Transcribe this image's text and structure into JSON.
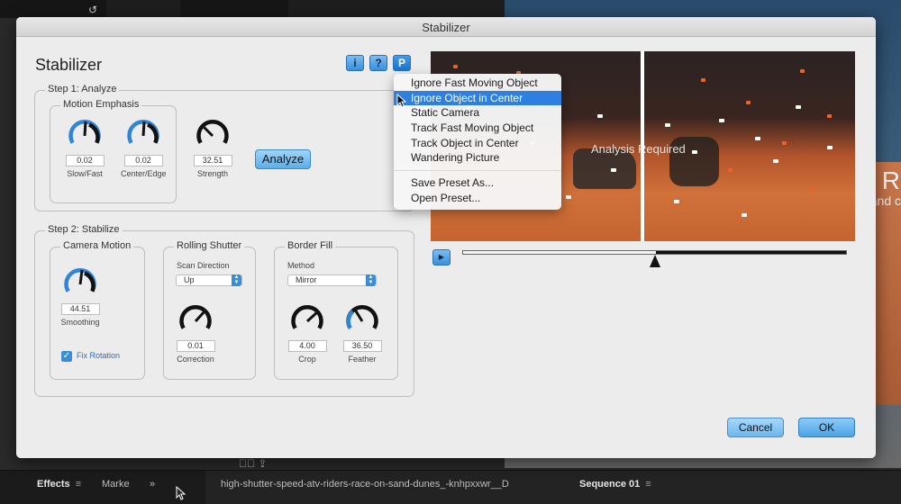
{
  "background": {
    "bottom_tabs": [
      {
        "label": "Effects",
        "active": true
      },
      {
        "label": "Marke",
        "active": false
      }
    ],
    "overflow_glyph": "»",
    "clip_name": "high-shutter-speed-atv-riders-race-on-sand-dunes_-knhpxxwr__D",
    "sequence_tab": "Sequence 01",
    "menu_glyph": "≡",
    "side_text_large": "s R",
    "side_text_small": "and c"
  },
  "dialog": {
    "window_title": "Stabilizer",
    "heading": "Stabilizer",
    "toolbar": {
      "info_label": "i",
      "help_label": "?",
      "preset_label": "P"
    },
    "step1": {
      "label": "Step 1: Analyze",
      "motion_emphasis_label": "Motion Emphasis",
      "knobs": [
        {
          "value": "0.02",
          "label": "Slow/Fast"
        },
        {
          "value": "0.02",
          "label": "Center/Edge"
        },
        {
          "value": "32.51",
          "label": "Strength"
        }
      ],
      "analyze_label": "Analyze"
    },
    "step2": {
      "label": "Step 2: Stabilize",
      "camera_motion": {
        "label": "Camera Motion",
        "knob": {
          "value": "44.51",
          "label": "Smoothing"
        },
        "fix_rotation_label": "Fix Rotation",
        "fix_rotation_checked": true
      },
      "rolling_shutter": {
        "label": "Rolling Shutter",
        "scan_direction_label": "Scan Direction",
        "scan_direction_value": "Up",
        "knob": {
          "value": "0.01",
          "label": "Correction"
        }
      },
      "border_fill": {
        "label": "Border Fill",
        "method_label": "Method",
        "method_value": "Mirror",
        "knobs": [
          {
            "value": "4.00",
            "label": "Crop"
          },
          {
            "value": "36.50",
            "label": "Feather"
          }
        ]
      }
    },
    "preview": {
      "message": "Analysis Required",
      "scrub_position": 0.5
    },
    "buttons": {
      "cancel": "Cancel",
      "ok": "OK"
    },
    "preset_menu": {
      "items": [
        "Ignore Fast Moving Object",
        "Ignore Object in Center",
        "Static Camera",
        "Track Fast Moving Object",
        "Track Object in Center",
        "Wandering Picture"
      ],
      "selected_index": 1,
      "actions": [
        "Save Preset As...",
        "Open Preset..."
      ]
    },
    "colors": {
      "accent": "#3a8ed9",
      "menu_highlight": "#2f7fe0",
      "knob_blue": "#2f86d8"
    }
  }
}
